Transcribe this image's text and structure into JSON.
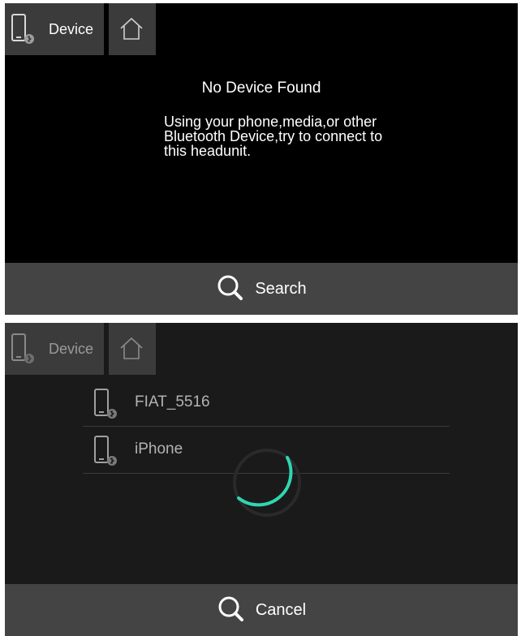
{
  "colors": {
    "accent": "#2fd6b0",
    "bar": "#444444",
    "tab": "#3b3b3b"
  },
  "top_screen": {
    "device_tab": {
      "label": "Device",
      "icon": "phone-bluetooth-icon"
    },
    "home_tab": {
      "icon": "home-icon"
    },
    "message": {
      "title": "No Device Found",
      "body": "Using your phone,media,or other\nBluetooth Device,try to connect to\nthis headunit."
    },
    "action": {
      "label": "Search",
      "icon": "search-icon"
    }
  },
  "bottom_screen": {
    "device_tab": {
      "label": "Device",
      "icon": "phone-bluetooth-icon"
    },
    "home_tab": {
      "icon": "home-icon"
    },
    "devices": [
      {
        "name": "FIAT_5516",
        "icon": "phone-bluetooth-icon"
      },
      {
        "name": "iPhone",
        "icon": "phone-bluetooth-icon"
      }
    ],
    "loading": {
      "icon": "loading-spinner-icon"
    },
    "action": {
      "label": "Cancel",
      "icon": "search-icon"
    }
  }
}
